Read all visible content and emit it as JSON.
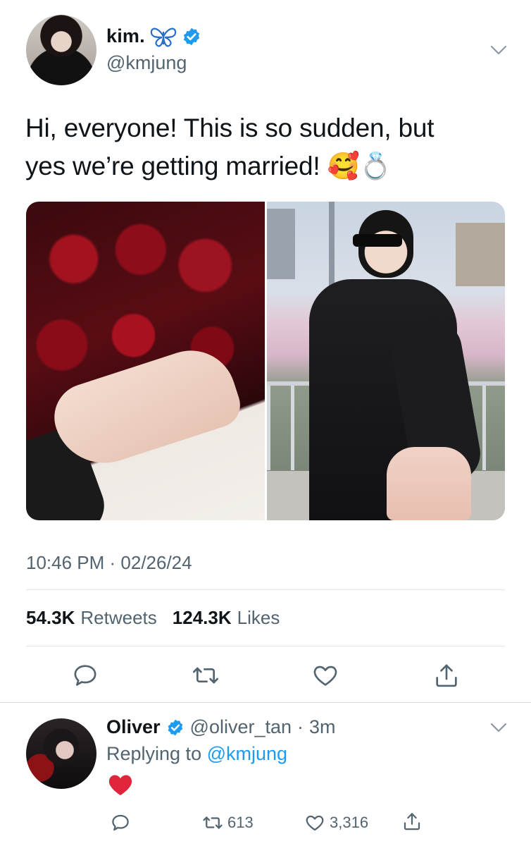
{
  "tweet": {
    "display_name": "kim.",
    "name_emoji": "🦋",
    "handle": "@kmjung",
    "text_line1": "Hi, everyone! This is so sudden, but",
    "text_line2": "yes we’re getting married! 🥰💍",
    "timestamp": "10:46 PM · 02/26/24",
    "retweets_count": "54.3K",
    "retweets_label": "Retweets",
    "likes_count": "124.3K",
    "likes_label": "Likes",
    "actions": [
      "reply-icon",
      "retweet-icon",
      "like-icon",
      "share-icon"
    ]
  },
  "reply": {
    "display_name": "Oliver",
    "handle": "@oliver_tan",
    "dot": "·",
    "time": "3m",
    "replying_prefix": "Replying to",
    "replying_to": "@kmjung",
    "body_emoji": "❤️",
    "retweet_count": "613",
    "like_count": "3,316"
  },
  "colors": {
    "accent": "#1d9bf0",
    "verified": "#1d9bf0",
    "muted": "#536471",
    "text": "#0f1419",
    "heart": "#e0245e"
  }
}
